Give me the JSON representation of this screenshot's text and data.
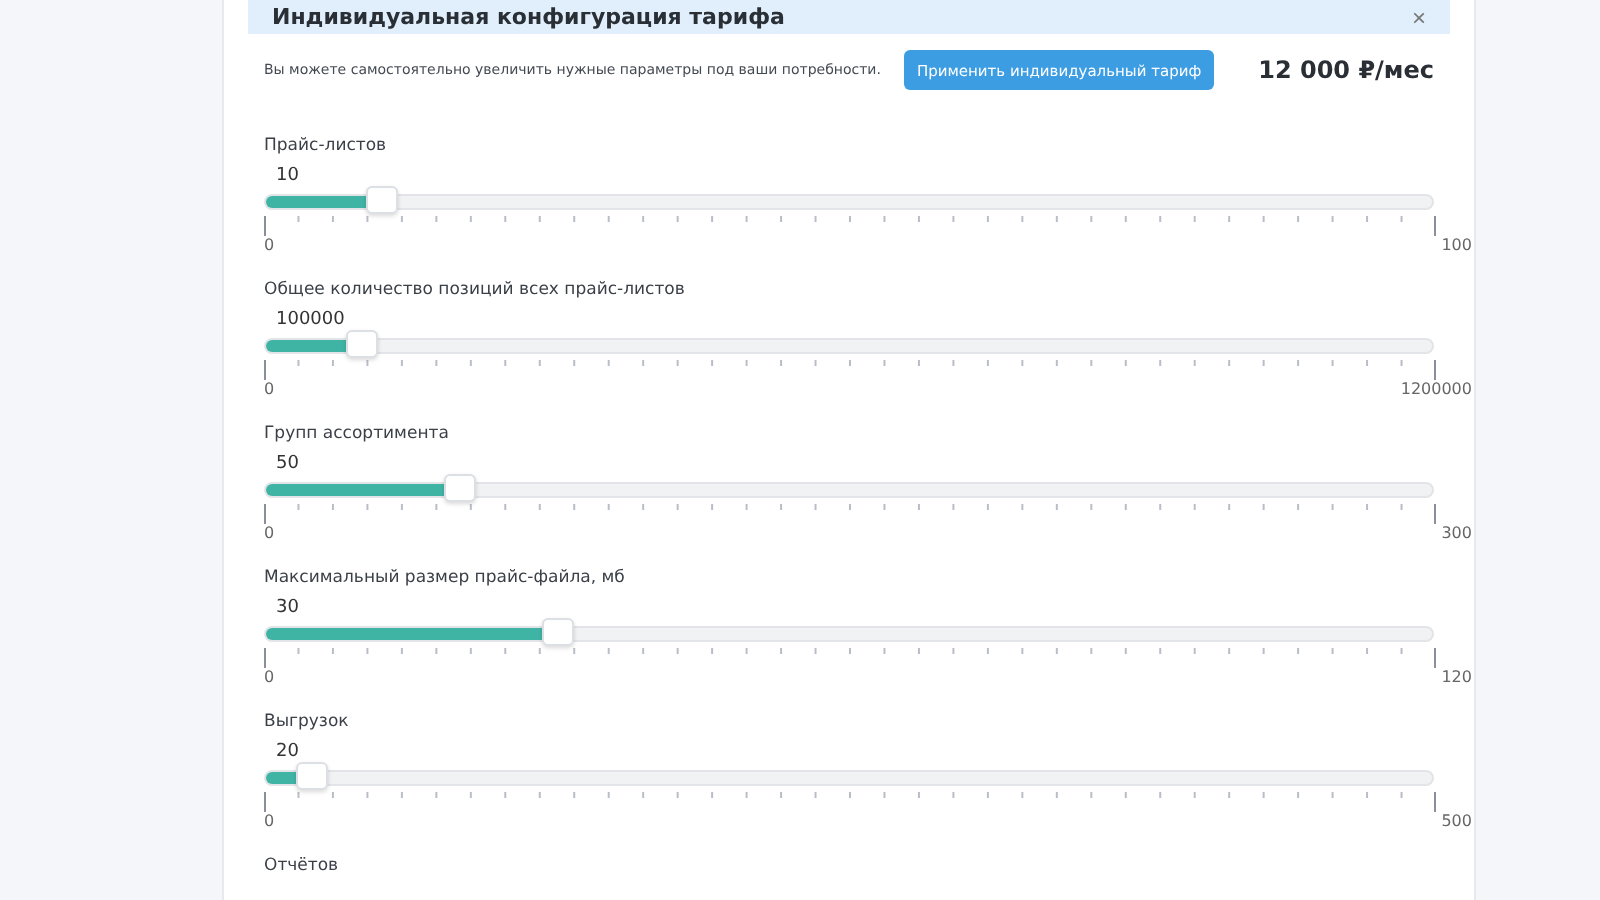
{
  "panel": {
    "title": "Индивидуальная конфигурация тарифа",
    "close": "×",
    "hint": "Вы можете самостоятельно увеличить нужные параметры под ваши потребности.",
    "apply_button": "Применить индивидуальный тариф",
    "price": "12 000 ₽/мес"
  },
  "sliders": [
    {
      "label": "Прайс-листов",
      "value": "10",
      "min": "0",
      "max": "100",
      "level": 0.1
    },
    {
      "label": "Общее количество позиций всех прайс-листов",
      "value": "100000",
      "min": "0",
      "max": "1200000",
      "level": 0.083
    },
    {
      "label": "Групп ассортимента",
      "value": "50",
      "min": "0",
      "max": "300",
      "level": 0.167
    },
    {
      "label": "Максимальный размер прайс-файла, мб",
      "value": "30",
      "min": "0",
      "max": "120",
      "level": 0.25
    },
    {
      "label": "Выгрузок",
      "value": "20",
      "min": "0",
      "max": "500",
      "level": 0.04
    },
    {
      "label": "Отчётов"
    }
  ]
}
